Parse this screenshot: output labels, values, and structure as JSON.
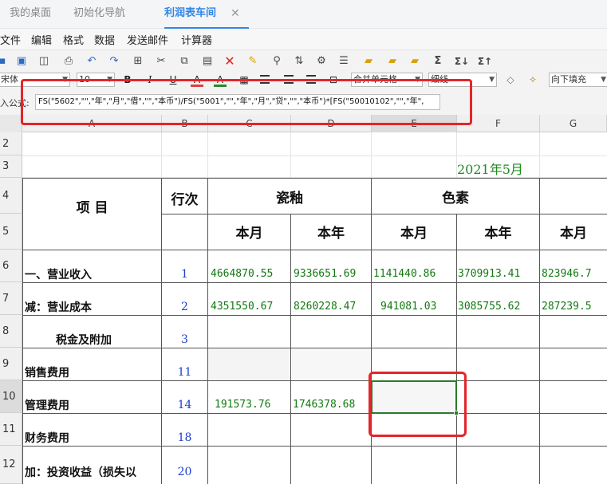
{
  "tabs": [
    {
      "label": "我的桌面",
      "active": false
    },
    {
      "label": "初始化导航",
      "active": false
    },
    {
      "label": "利润表车间",
      "active": true
    }
  ],
  "tab_close": "✕",
  "menu": [
    "文件",
    "编辑",
    "格式",
    "数据",
    "发送邮件",
    "计算器"
  ],
  "toolbar": {
    "icons": [
      "save-icon",
      "save-as-icon",
      "print-preview-icon",
      "print-icon",
      "undo-icon",
      "redo-icon",
      "fit-icon",
      "cut-icon",
      "copy-icon",
      "paste-icon",
      "delete-icon",
      "format-brush-icon",
      "find-icon",
      "sort-icon",
      "settings-icon",
      "folder-icon",
      "folder2-icon",
      "sum-icon",
      "sum-down-icon",
      "sum-up-icon"
    ],
    "sum": "Σ",
    "sum_down": "Σ↓",
    "sum_up": "Σ↑"
  },
  "format": {
    "font": "宋体",
    "size": "10",
    "bold": "B",
    "italic": "I",
    "underline": "U",
    "color_a": "A",
    "fill_a": "A",
    "merge": "合并单元格",
    "border": "细线",
    "fill_down": "向下填充"
  },
  "formula": {
    "label": "入公式:",
    "value": "FS(\"5602\",\"\",\"年\",\"月\",\"借\",\"\",\"本币\")/FS(\"5001\",\"\",\"年\",\"月\",\"贷\",\"\",\"本币\")*[FS(\"50010102\",\"\",\"年\","
  },
  "sheet": {
    "columns": [
      "A",
      "B",
      "C",
      "D",
      "E",
      "F",
      "G"
    ],
    "rows": [
      "2",
      "3",
      "4",
      "5",
      "6",
      "7",
      "8",
      "9",
      "10",
      "11",
      "12"
    ],
    "date": "2021年5月",
    "header": {
      "item": "项    目",
      "line_no": "行次",
      "group1": "瓷釉",
      "group2": "色素",
      "month": "本月",
      "year": "本年"
    },
    "data": [
      {
        "label": "一、营业收入",
        "line": "1",
        "c": "4664870.55",
        "d": "9336651.69",
        "e": "1141440.86",
        "f": "3709913.41",
        "g": "823946.7"
      },
      {
        "label": "减：营业成本",
        "line": "2",
        "c": "4351550.67",
        "d": "8260228.47",
        "e": "941081.03",
        "f": "3085755.62",
        "g": "287239.5"
      },
      {
        "label": "税金及附加",
        "line": "3",
        "c": "",
        "d": "",
        "e": "",
        "f": "",
        "g": ""
      },
      {
        "label": "销售费用",
        "line": "11",
        "c": "",
        "d": "",
        "e": "",
        "f": "",
        "g": ""
      },
      {
        "label": "管理费用",
        "line": "14",
        "c": "191573.76",
        "d": "1746378.68",
        "e": "",
        "f": "",
        "g": ""
      },
      {
        "label": "财务费用",
        "line": "18",
        "c": "",
        "d": "",
        "e": "",
        "f": "",
        "g": ""
      },
      {
        "label": "加：投资收益（损失以",
        "line": "20",
        "c": "",
        "d": "",
        "e": "",
        "f": "",
        "g": ""
      }
    ]
  },
  "colors": {
    "accent": "#2f86e8",
    "number": "#117a11",
    "line_no": "#1a3fcf",
    "highlight": "#e3262b",
    "selection": "#2b7a2b"
  }
}
